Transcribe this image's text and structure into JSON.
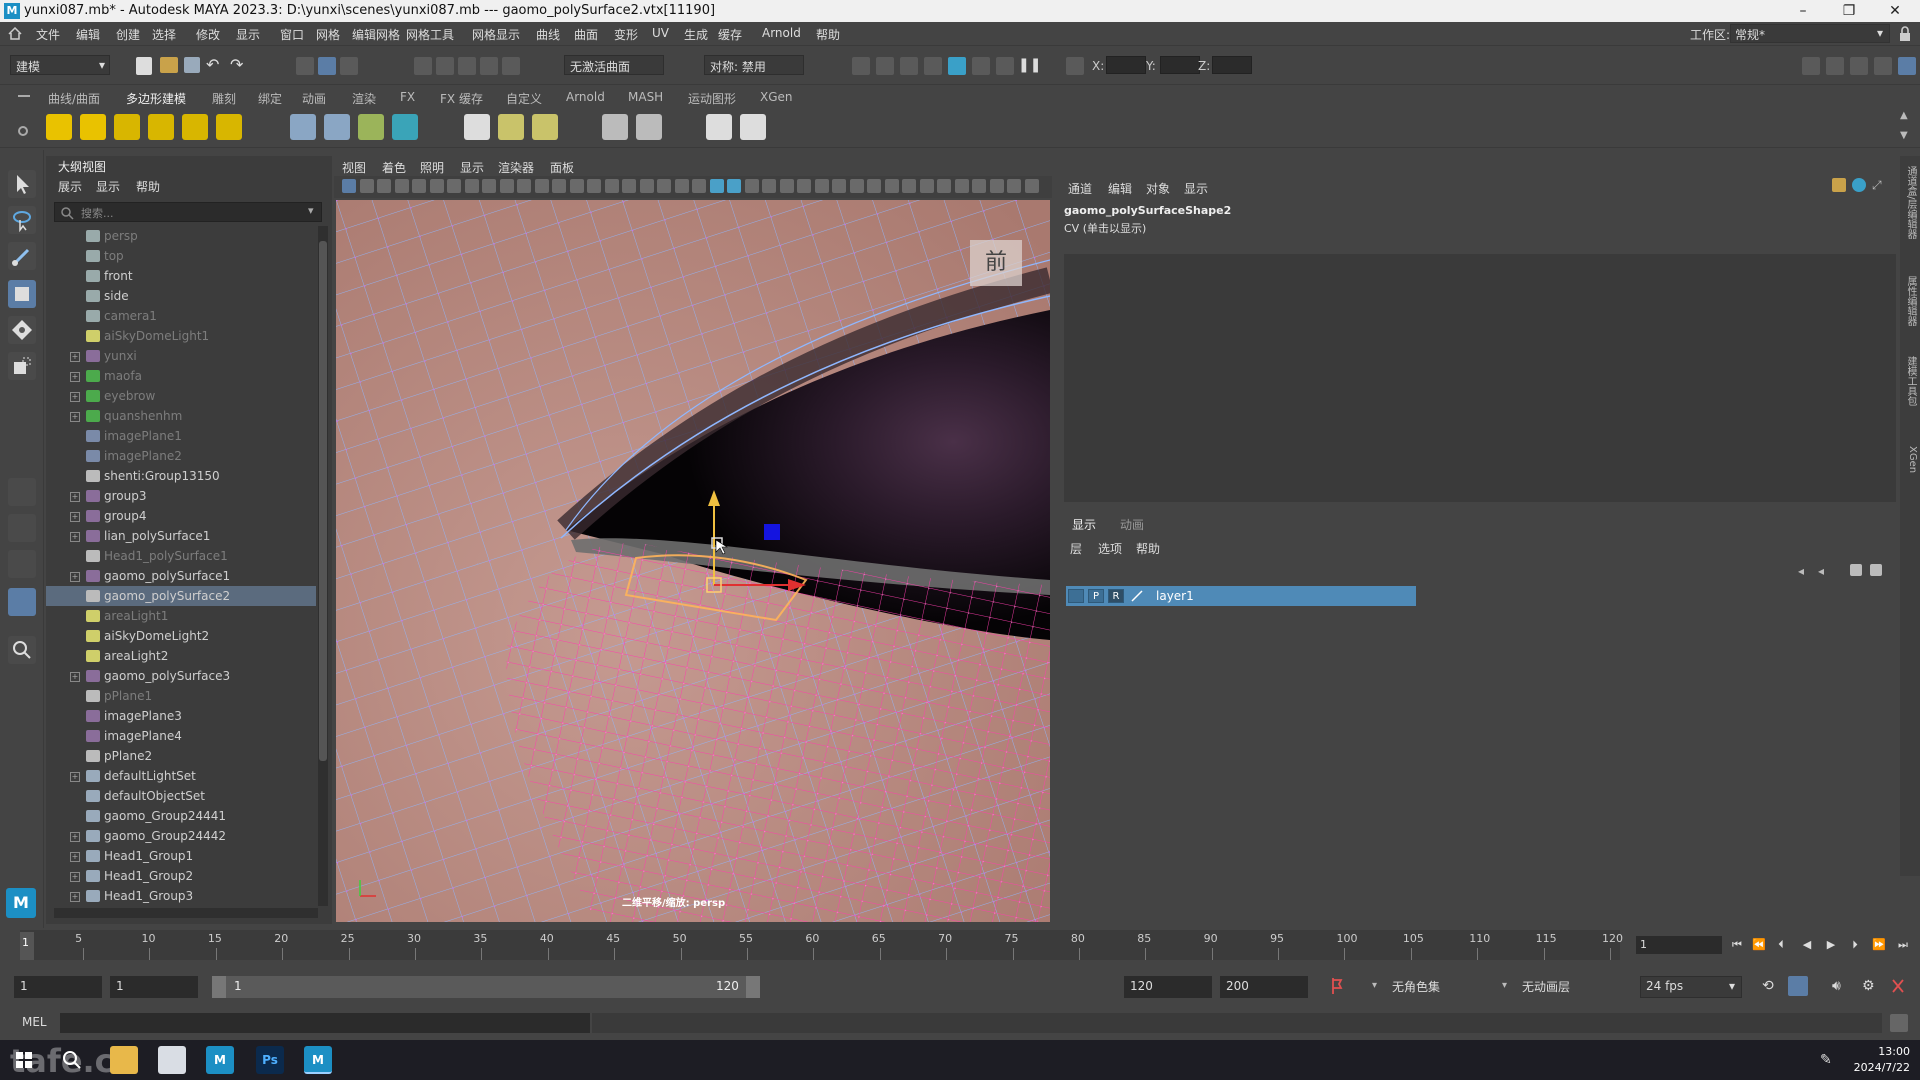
{
  "window": {
    "title": "yunxi087.mb* - Autodesk MAYA 2023.3: D:\\yunxi\\scenes\\yunxi087.mb   ---   gaomo_polySurface2.vtx[11190]",
    "minimize": "–",
    "maximize": "❐",
    "close": "✕"
  },
  "menubar": {
    "items": [
      "文件",
      "编辑",
      "创建",
      "选择",
      "修改",
      "显示",
      "窗口",
      "网格",
      "编辑网格",
      "网格工具",
      "网格显示",
      "曲线",
      "曲面",
      "变形",
      "UV",
      "生成",
      "缓存",
      "Arnold",
      "帮助"
    ],
    "workspace_label": "工作区:",
    "workspace_value": "常规*"
  },
  "statusline": {
    "mode": "建模",
    "live_surface": "无激活曲面",
    "symmetry": "对称: 禁用",
    "x_label": "X:",
    "y_label": "Y:",
    "z_label": "Z:"
  },
  "shelf": {
    "tabs": [
      "曲线/曲面",
      "多边形建模",
      "雕刻",
      "绑定",
      "动画",
      "渲染",
      "FX",
      "FX 缓存",
      "自定义",
      "Arnold",
      "MASH",
      "运动图形",
      "XGen"
    ]
  },
  "outliner": {
    "title": "大纲视图",
    "menu": [
      "展示",
      "显示",
      "帮助"
    ],
    "search_placeholder": "搜索...",
    "items": [
      {
        "label": "persp",
        "dim": true,
        "exp": false,
        "icon": "camera"
      },
      {
        "label": "top",
        "dim": true,
        "exp": false,
        "icon": "camera"
      },
      {
        "label": "front",
        "dim": false,
        "exp": false,
        "icon": "camera"
      },
      {
        "label": "side",
        "dim": false,
        "exp": false,
        "icon": "camera"
      },
      {
        "label": "camera1",
        "dim": true,
        "exp": false,
        "icon": "camera"
      },
      {
        "label": "aiSkyDomeLight1",
        "dim": true,
        "exp": false,
        "icon": "light"
      },
      {
        "label": "yunxi",
        "dim": true,
        "exp": true,
        "icon": "mesh"
      },
      {
        "label": "maofa",
        "dim": true,
        "exp": true,
        "icon": "group"
      },
      {
        "label": "eyebrow",
        "dim": true,
        "exp": true,
        "icon": "group"
      },
      {
        "label": "quanshenhm",
        "dim": true,
        "exp": true,
        "icon": "group"
      },
      {
        "label": "imagePlane1",
        "dim": true,
        "exp": false,
        "icon": "image"
      },
      {
        "label": "imagePlane2",
        "dim": true,
        "exp": false,
        "icon": "image"
      },
      {
        "label": "shenti:Group13150",
        "dim": false,
        "exp": false,
        "icon": "transform"
      },
      {
        "label": "group3",
        "dim": false,
        "exp": true,
        "icon": "mesh"
      },
      {
        "label": "group4",
        "dim": false,
        "exp": true,
        "icon": "mesh"
      },
      {
        "label": "lian_polySurface1",
        "dim": false,
        "exp": true,
        "icon": "mesh"
      },
      {
        "label": "Head1_polySurface1",
        "dim": true,
        "exp": false,
        "icon": "transform"
      },
      {
        "label": "gaomo_polySurface1",
        "dim": false,
        "exp": true,
        "icon": "mesh"
      },
      {
        "label": "gaomo_polySurface2",
        "dim": false,
        "exp": false,
        "icon": "transform",
        "selected": true
      },
      {
        "label": "areaLight1",
        "dim": true,
        "exp": false,
        "icon": "alight"
      },
      {
        "label": "aiSkyDomeLight2",
        "dim": false,
        "exp": false,
        "icon": "light"
      },
      {
        "label": "areaLight2",
        "dim": false,
        "exp": false,
        "icon": "alight"
      },
      {
        "label": "gaomo_polySurface3",
        "dim": false,
        "exp": true,
        "icon": "mesh"
      },
      {
        "label": "pPlane1",
        "dim": true,
        "exp": false,
        "icon": "transform"
      },
      {
        "label": "imagePlane3",
        "dim": false,
        "exp": false,
        "icon": "mesh"
      },
      {
        "label": "imagePlane4",
        "dim": false,
        "exp": false,
        "icon": "mesh"
      },
      {
        "label": "pPlane2",
        "dim": false,
        "exp": false,
        "icon": "transform"
      },
      {
        "label": "defaultLightSet",
        "dim": false,
        "exp": true,
        "icon": "set"
      },
      {
        "label": "defaultObjectSet",
        "dim": false,
        "exp": false,
        "icon": "set"
      },
      {
        "label": "gaomo_Group24441",
        "dim": false,
        "exp": false,
        "icon": "set"
      },
      {
        "label": "gaomo_Group24442",
        "dim": false,
        "exp": true,
        "icon": "set"
      },
      {
        "label": "Head1_Group1",
        "dim": false,
        "exp": true,
        "icon": "set"
      },
      {
        "label": "Head1_Group2",
        "dim": false,
        "exp": true,
        "icon": "set"
      },
      {
        "label": "Head1_Group3",
        "dim": false,
        "exp": true,
        "icon": "set"
      }
    ]
  },
  "viewport": {
    "menu": [
      "视图",
      "着色",
      "照明",
      "显示",
      "渲染器",
      "面板"
    ],
    "camera_label": "前",
    "hud_text": "二维平移/缩放: persp"
  },
  "channelbox": {
    "menu": [
      "通道",
      "编辑",
      "对象",
      "显示"
    ],
    "object_name": "gaomo_polySurfaceShape2",
    "cv_hint": "CV (单击以显示)"
  },
  "layereditor": {
    "tabs": [
      "显示",
      "动画"
    ],
    "menu": [
      "层",
      "选项",
      "帮助"
    ],
    "layer": {
      "v": "",
      "p": "P",
      "r": "R",
      "name": "layer1"
    }
  },
  "side_tabs": [
    "通道盒/层编辑器",
    "属性编辑器",
    "建模工具包",
    "XGen"
  ],
  "timeline": {
    "ticks": [
      5,
      10,
      15,
      20,
      25,
      30,
      35,
      40,
      45,
      50,
      55,
      60,
      65,
      70,
      75,
      80,
      85,
      90,
      95,
      100,
      105,
      110,
      115,
      120
    ],
    "start_frame": 1,
    "current_frame": "1"
  },
  "range": {
    "start": "1",
    "anim_start": "1",
    "slider_start": "1",
    "slider_end": "120",
    "end": "120",
    "anim_end": "200",
    "character_set": "无角色集",
    "anim_layer": "无动画层",
    "fps": "24 fps"
  },
  "cmdline": {
    "label": "MEL"
  },
  "taskbar": {
    "watermark": "tafe.cc",
    "time": "13:00",
    "date": "2024/7/22",
    "apps": [
      "M",
      "Ps",
      "M"
    ]
  },
  "colors": {
    "accent_selection": "#4f8ab7",
    "skin": "#b98a83",
    "wire_blue": "#8fb7ff",
    "wire_magenta": "#ff3cae",
    "wire_orange": "#ffb45a"
  }
}
